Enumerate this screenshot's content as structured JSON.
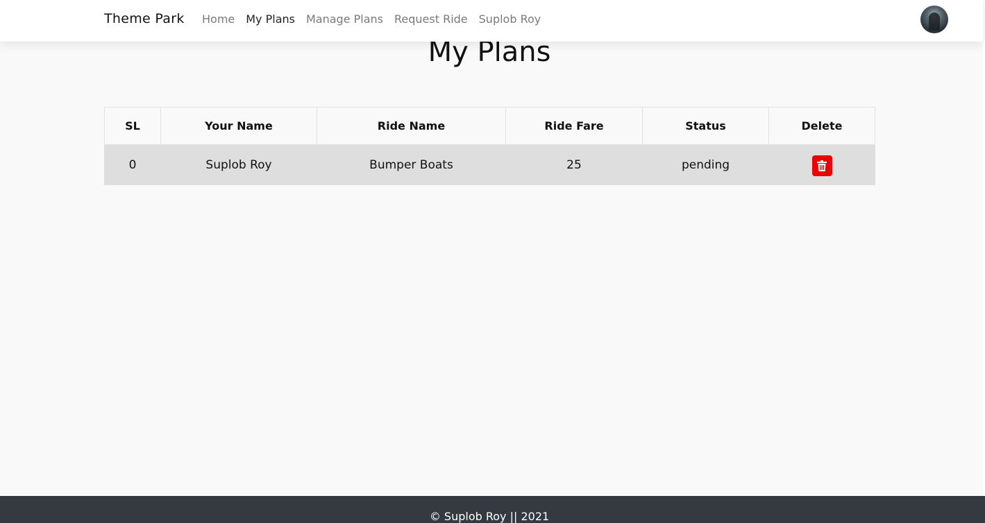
{
  "navbar": {
    "brand": "Theme Park",
    "links": [
      {
        "label": "Home"
      },
      {
        "label": "My Plans"
      },
      {
        "label": "Manage Plans"
      },
      {
        "label": "Request Ride"
      },
      {
        "label": "Suplob Roy"
      }
    ],
    "active_link": "My Plans",
    "avatar_icon": "user-avatar"
  },
  "main": {
    "title": "My Plans",
    "table": {
      "headers": [
        "SL",
        "Your Name",
        "Ride Name",
        "Ride Fare",
        "Status",
        "Delete"
      ],
      "rows": [
        {
          "sl": "0",
          "your_name": "Suplob Roy",
          "ride_name": "Bumper Boats",
          "ride_fare": "25",
          "status": "pending",
          "delete_icon": "trash-icon"
        }
      ]
    }
  },
  "footer": {
    "text": "© Suplob Roy || 2021"
  },
  "colors": {
    "navbar_bg": "#ffffff",
    "page_bg": "#f9f9f9",
    "row_bg": "#dedede",
    "delete_button": "#ee0000",
    "footer_bg": "#343a40"
  }
}
